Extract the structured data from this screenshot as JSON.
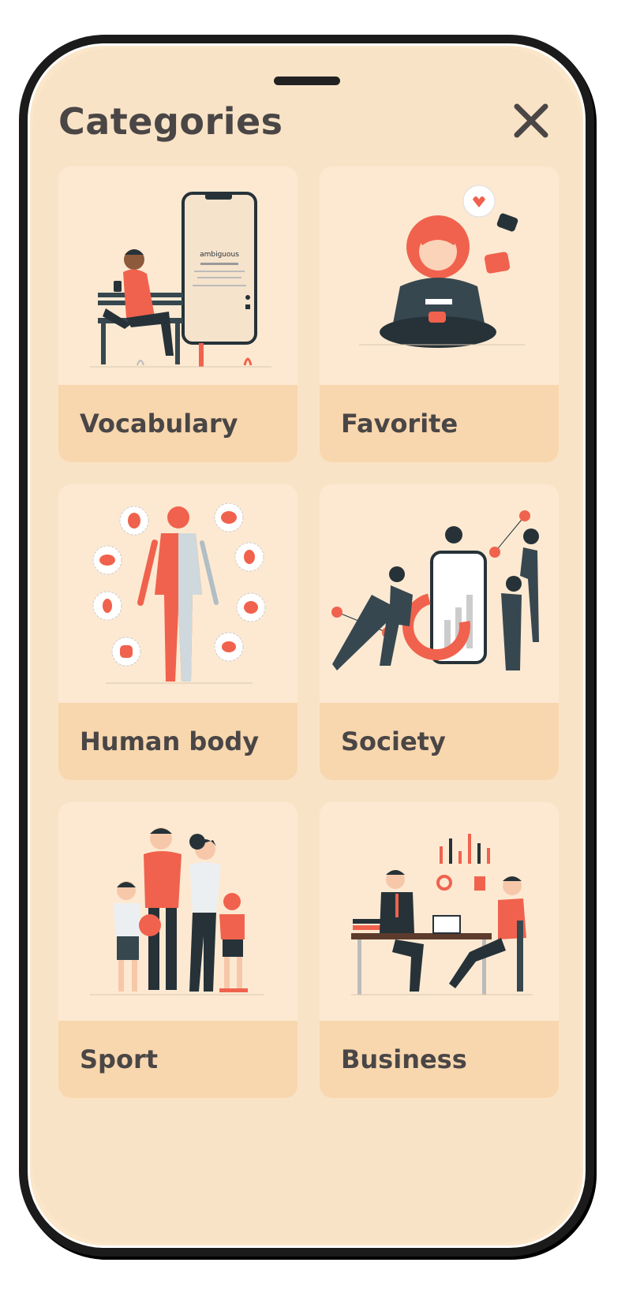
{
  "header": {
    "title": "Categories",
    "close_icon": "close-icon"
  },
  "phone_demo": {
    "word": "ambiguous"
  },
  "categories": [
    {
      "label": "Vocabulary",
      "icon": "person-on-bench-with-phone-illustration"
    },
    {
      "label": "Favorite",
      "icon": "person-with-likes-illustration"
    },
    {
      "label": "Human body",
      "icon": "anatomy-organs-illustration"
    },
    {
      "label": "Society",
      "icon": "team-chart-illustration"
    },
    {
      "label": "Sport",
      "icon": "family-sport-illustration"
    },
    {
      "label": "Business",
      "icon": "business-meeting-illustration"
    }
  ],
  "colors": {
    "background": "#f9e3c6",
    "card": "#fde9d2",
    "label_band": "#f8d7ae",
    "text": "#4a4646",
    "accent": "#f0624d",
    "ink": "#263238"
  }
}
